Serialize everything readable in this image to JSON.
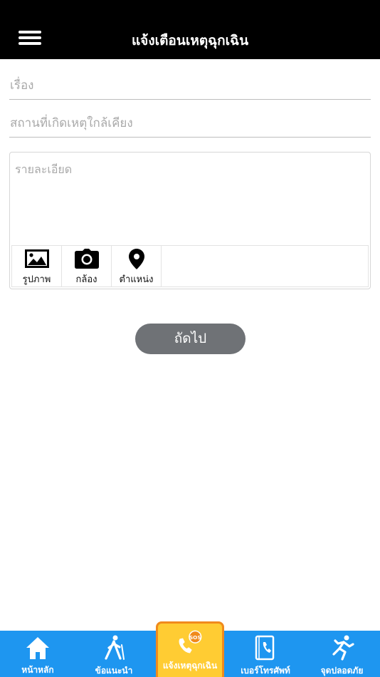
{
  "header": {
    "title": "แจ้งเตือนเหตุฉุกเฉิน",
    "menu_icon": "hamburger-menu-icon"
  },
  "form": {
    "subject_placeholder": "เรื่อง",
    "location_placeholder": "สถานที่เกิดเหตุใกล้เคียง",
    "detail_placeholder": "รายละเอียด",
    "attachments": [
      {
        "label": "รูปภาพ",
        "icon": "image-icon"
      },
      {
        "label": "กล้อง",
        "icon": "camera-icon"
      },
      {
        "label": "ตำแหน่ง",
        "icon": "location-pin-icon"
      }
    ],
    "next_label": "ถัดไป"
  },
  "tabbar": {
    "colors": {
      "bar": "#1e96f0",
      "active_bg": "#ffcc33",
      "active_border": "#f08a1c"
    },
    "items": [
      {
        "label": "หน้าหลัก",
        "icon": "home-icon"
      },
      {
        "label": "ข้อแนะนำ",
        "icon": "walking-person-icon"
      },
      {
        "label": "แจ้งเหตุฉุกเฉิน",
        "icon": "sos-phone-icon",
        "active": true
      },
      {
        "label": "เบอร์โทรศัพท์",
        "icon": "phone-book-icon"
      },
      {
        "label": "จุดปลอดภัย",
        "icon": "running-person-icon"
      }
    ]
  }
}
